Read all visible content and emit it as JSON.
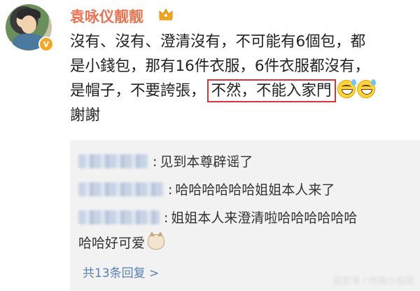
{
  "post": {
    "username": "袁咏仪靓靓",
    "lines": [
      "沒有、沒有、澄清沒有，不可能有6個包，都",
      "是小錢包，那有16件衣服，6件衣服都沒有，",
      "是帽子，不要誇張，",
      "謝謝"
    ],
    "highlighted_text": "不然，不能入家門"
  },
  "comments": [
    {
      "text": "见到本尊辟谣了"
    },
    {
      "text": "哈哈哈哈哈哈姐姐本人来了"
    },
    {
      "text": "姐姐本人来澄清啦哈哈哈哈哈哈",
      "continuation": "哈哈好可爱"
    }
  ],
  "reply_link": "共13条回复 >",
  "watermark": "百家号 / 时尚小猪哥",
  "icons": {
    "verified": "verified-badge-icon",
    "crown": "crown-icon",
    "emoji": "grinning-sweat-emoji-icon",
    "cat": "cat-emoji-icon"
  },
  "colors": {
    "username": "#eb7350",
    "highlight_border": "#d9343a",
    "link": "#5a7fb5",
    "comment_bg": "#f2f2f2"
  }
}
